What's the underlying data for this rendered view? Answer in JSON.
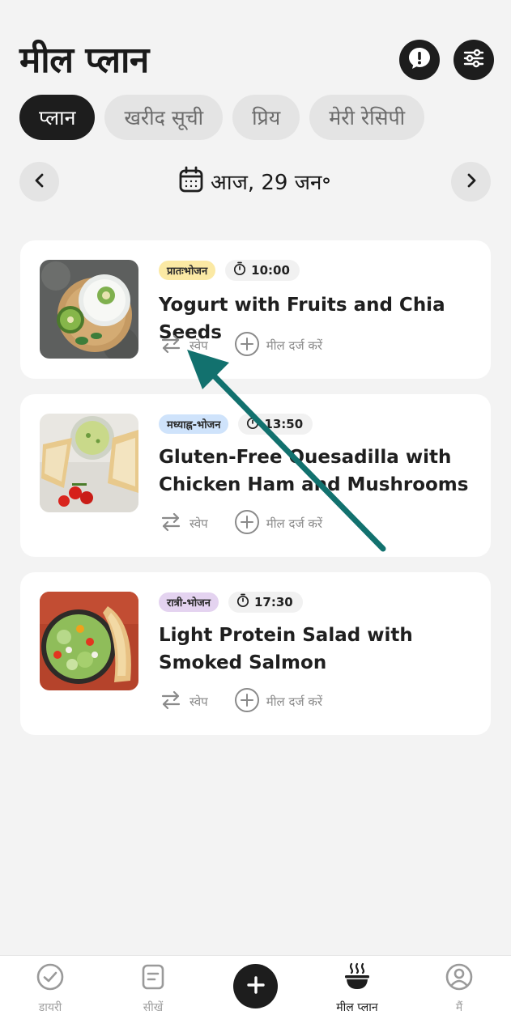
{
  "header": {
    "title": "मील प्लान",
    "alert_icon": "alert-bubble-icon",
    "settings_icon": "sliders-icon"
  },
  "tabs": [
    {
      "label": "प्लान",
      "active": true
    },
    {
      "label": "खरीद सूची",
      "active": false
    },
    {
      "label": "प्रिय",
      "active": false
    },
    {
      "label": "मेरी रेसिपी",
      "active": false
    }
  ],
  "date_nav": {
    "date_label": "आज, 29 जन॰",
    "prev_icon": "chevron-left-icon",
    "next_icon": "chevron-right-icon",
    "calendar_icon": "calendar-icon"
  },
  "meals": [
    {
      "badge": "प्रातःभोजन",
      "badge_kind": "breakfast",
      "time": "10:00",
      "title": "Yogurt with Fruits and Chia Seeds",
      "swap_label": "स्वेप",
      "log_label": "मील दर्ज करें"
    },
    {
      "badge": "मध्याह्न-भोजन",
      "badge_kind": "lunch",
      "time": "13:50",
      "title": "Gluten-Free Quesadilla with Chicken Ham and Mushrooms",
      "swap_label": "स्वेप",
      "log_label": "मील दर्ज करें"
    },
    {
      "badge": "रात्री-भोजन",
      "badge_kind": "dinner",
      "time": "17:30",
      "title": "Light Protein Salad with Smoked Salmon",
      "swap_label": "स्वेप",
      "log_label": "मील दर्ज करें"
    }
  ],
  "bottom_nav": [
    {
      "label": "डायरी",
      "icon": "check-circle-icon",
      "active": false
    },
    {
      "label": "सीखें",
      "icon": "notes-icon",
      "active": false
    },
    {
      "label": "",
      "icon": "plus-icon",
      "active": false
    },
    {
      "label": "मील प्लान",
      "icon": "bowl-icon",
      "active": true
    },
    {
      "label": "मैं",
      "icon": "user-circle-icon",
      "active": false
    }
  ],
  "colors": {
    "background": "#f3f3f3",
    "dark": "#1d1d1d",
    "annotation_arrow": "#12716e",
    "badge_breakfast": "#fbe9a4",
    "badge_lunch": "#cfe3fb",
    "badge_dinner": "#e4d3f0"
  }
}
